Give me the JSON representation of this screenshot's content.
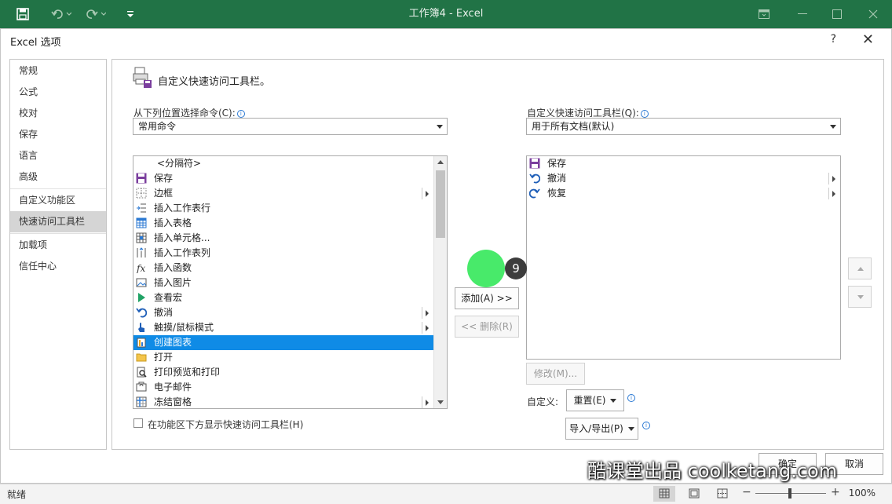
{
  "window": {
    "title": "工作簿4 - Excel",
    "accent": "#217346"
  },
  "dialog": {
    "title": "Excel 选项",
    "help": "?",
    "close": "✕"
  },
  "nav": {
    "items": [
      "常规",
      "公式",
      "校对",
      "保存",
      "语言",
      "高级"
    ],
    "items2": [
      "自定义功能区",
      "快速访问工具栏"
    ],
    "items3": [
      "加载项",
      "信任中心"
    ],
    "selected": "快速访问工具栏"
  },
  "main": {
    "heading": "自定义快速访问工具栏。",
    "choose_label": "从下列位置选择命令(C):",
    "choose_value": "常用命令",
    "customize_label": "自定义快速访问工具栏(Q):",
    "customize_value": "用于所有文档(默认)",
    "commands": [
      {
        "label": "<分隔符>",
        "icon": "separator"
      },
      {
        "label": "保存",
        "icon": "save-icon"
      },
      {
        "label": "边框",
        "icon": "border-icon",
        "submenu": true
      },
      {
        "label": "插入工作表行",
        "icon": "insert-row-icon"
      },
      {
        "label": "插入表格",
        "icon": "insert-table-icon"
      },
      {
        "label": "插入单元格...",
        "icon": "insert-cells-icon"
      },
      {
        "label": "插入工作表列",
        "icon": "insert-column-icon"
      },
      {
        "label": "插入函数",
        "icon": "function-icon"
      },
      {
        "label": "插入图片",
        "icon": "picture-icon"
      },
      {
        "label": "查看宏",
        "icon": "play-icon"
      },
      {
        "label": "撤消",
        "icon": "undo-icon",
        "submenu": true
      },
      {
        "label": "触摸/鼠标模式",
        "icon": "touch-icon",
        "submenu": true
      },
      {
        "label": "创建图表",
        "icon": "chart-icon",
        "selected": true
      },
      {
        "label": "打开",
        "icon": "folder-icon"
      },
      {
        "label": "打印预览和打印",
        "icon": "print-preview-icon"
      },
      {
        "label": "电子邮件",
        "icon": "mail-icon"
      },
      {
        "label": "冻结窗格",
        "icon": "freeze-panes-icon",
        "submenu": true
      }
    ],
    "toolbar_items": [
      {
        "label": "保存",
        "icon": "save-icon"
      },
      {
        "label": "撤消",
        "icon": "undo-icon",
        "submenu": true
      },
      {
        "label": "恢复",
        "icon": "redo-icon",
        "submenu": true
      }
    ],
    "add_button": "添加(A) >>",
    "remove_button": "<< 删除(R)",
    "modify_button": "修改(M)...",
    "customize_label2": "自定义:",
    "reset_button": "重置(E)",
    "import_export_button": "导入/导出(P)",
    "show_below_label": "在功能区下方显示快速访问工具栏(H)",
    "ok_button": "确定",
    "cancel_button": "取消",
    "step_number": "9"
  },
  "status": {
    "text": "就绪",
    "zoom": "100%",
    "zoom_fraction": 0.5
  },
  "watermark": "酷课堂出品 coolketang.com"
}
